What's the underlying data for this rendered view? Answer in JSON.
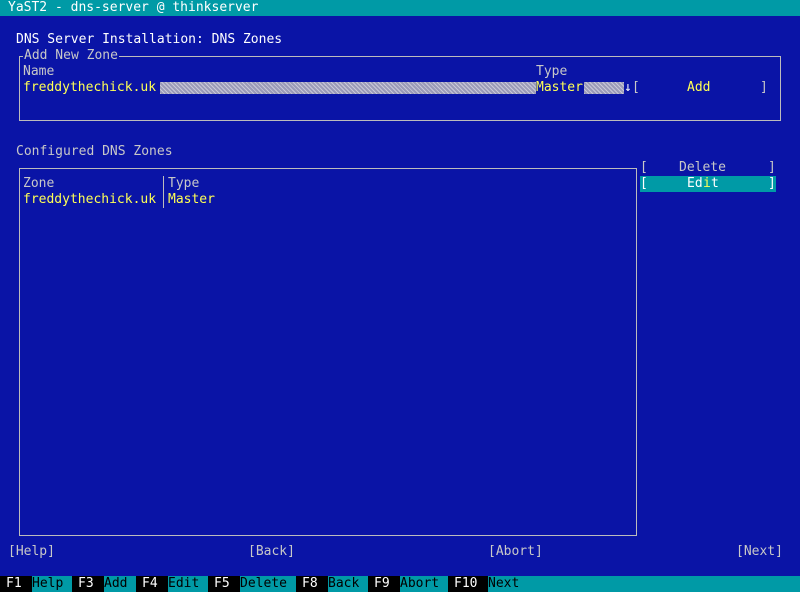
{
  "window": {
    "title": "YaST2 - dns-server @ thinkserver"
  },
  "dialog": {
    "heading": "DNS Server Installation: DNS Zones"
  },
  "add_zone": {
    "frame_label": "Add New Zone",
    "name_label": "Name",
    "name_value": "freddythechick.uk",
    "type_label": "Type",
    "type_value": "Master",
    "dropdown_arrow": "↓",
    "add_button": {
      "open": "[",
      "label": "Add",
      "close": "]"
    }
  },
  "zones": {
    "section_label": "Configured DNS Zones",
    "columns": [
      "Zone",
      "Type"
    ],
    "rows": [
      {
        "zone": "freddythechick.uk",
        "type": "Master"
      }
    ]
  },
  "side_buttons": {
    "delete": {
      "open": "[",
      "label": "Delete",
      "close": "]"
    },
    "edit": {
      "open": "[",
      "label_pre": "Ed",
      "hotkey": "i",
      "label_post": "t",
      "close": "]"
    }
  },
  "bottom_buttons": {
    "help": "[Help]",
    "back": "[Back]",
    "abort": "[Abort]",
    "next": "[Next]"
  },
  "fkeys": [
    {
      "key": "F1",
      "label": "Help"
    },
    {
      "key": "F3",
      "label": "Add"
    },
    {
      "key": "F4",
      "label": "Edit"
    },
    {
      "key": "F5",
      "label": "Delete"
    },
    {
      "key": "F8",
      "label": "Back"
    },
    {
      "key": "F9",
      "label": "Abort"
    },
    {
      "key": "F10",
      "label": "Next"
    }
  ],
  "colors": {
    "background": "#0a14a6",
    "accent": "#009aa6",
    "highlight_text": "#ffff55"
  }
}
